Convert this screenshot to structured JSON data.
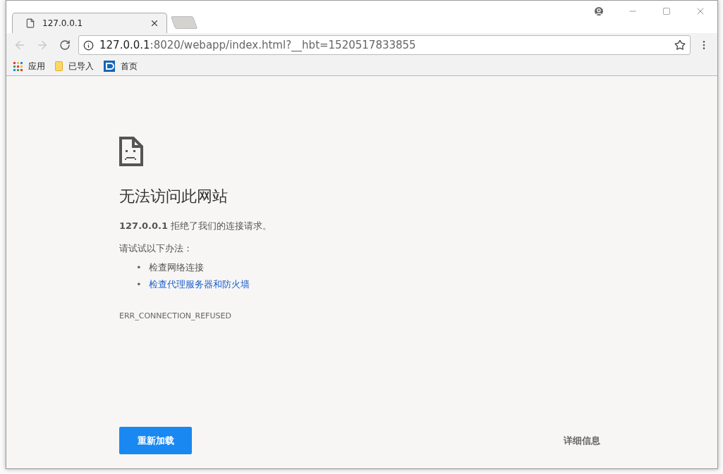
{
  "tabs": [
    {
      "title": "127.0.0.1",
      "selected": true
    }
  ],
  "toolbar": {
    "back": {
      "disabled": true
    },
    "forward": {
      "disabled": true
    },
    "address": {
      "host": "127.0.0.1",
      "path": ":8020/webapp/index.html?__hbt=1520517833855"
    }
  },
  "bookmarks": [
    {
      "label": "应用",
      "kind": "apps"
    },
    {
      "label": "已导入",
      "kind": "folder"
    },
    {
      "label": "首页",
      "kind": "site"
    }
  ],
  "error": {
    "title": "无法访问此网站",
    "message": "**127.0.0.1** 拒绝了我们的连接请求。",
    "suggestions_heading": "请试试以下办法：",
    "suggestions": [
      {
        "bullet": "•",
        "text": "检查网络连接",
        "kind": "text"
      },
      {
        "bullet": "•",
        "text": "检查代理服务器和防火墙",
        "kind": "link"
      }
    ],
    "code": "ERR_CONNECTION_REFUSED"
  },
  "buttons": {
    "reload": "重新加载",
    "details": "详细信息"
  }
}
